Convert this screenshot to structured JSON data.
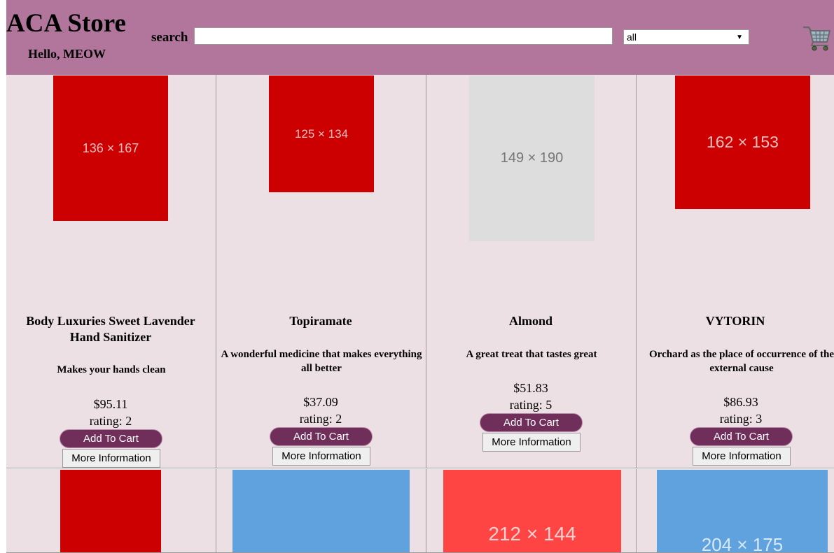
{
  "header": {
    "store_title": "ACA Store",
    "greeting": "Hello, MEOW",
    "search_label": "search",
    "search_value": "",
    "category_selected": "all",
    "background_color": "#b2769c"
  },
  "products": [
    {
      "name": "Body Luxuries Sweet Lavender Hand Sanitizer",
      "description": "Makes your hands clean",
      "price": "$95.11",
      "rating": "rating: 2",
      "image_label": "136 × 167",
      "image_color": "#cc0000",
      "add_to_cart_label": "Add To Cart",
      "more_info_label": "More Information"
    },
    {
      "name": "Topiramate",
      "description": "A wonderful medicine that makes everything all better",
      "price": "$37.09",
      "rating": "rating: 2",
      "image_label": "125 × 134",
      "image_color": "#cc0000",
      "add_to_cart_label": "Add To Cart",
      "more_info_label": "More Information"
    },
    {
      "name": "Almond",
      "description": "A great treat that tastes great",
      "price": "$51.83",
      "rating": "rating: 5",
      "image_label": "149 × 190",
      "image_color": "#dddddd",
      "add_to_cart_label": "Add To Cart",
      "more_info_label": "More Information"
    },
    {
      "name": "VYTORIN",
      "description": "Orchard as the place of occurrence of the external cause",
      "price": "$86.93",
      "rating": "rating: 3",
      "image_label": "162 × 153",
      "image_color": "#cc0000",
      "add_to_cart_label": "Add To Cart",
      "more_info_label": "More Information"
    }
  ],
  "second_row_images": [
    {
      "image_label": "",
      "image_color": "#cc0000"
    },
    {
      "image_label": "",
      "image_color": "#5fa2dd"
    },
    {
      "image_label": "212 × 144",
      "image_color": "#ff4444"
    },
    {
      "image_label": "204 × 175",
      "image_color": "#5fa2dd"
    }
  ],
  "colors": {
    "card_background": "#ede0e5",
    "button_primary": "#702f5b"
  },
  "icons": {
    "cart": "shopping-cart-icon"
  }
}
